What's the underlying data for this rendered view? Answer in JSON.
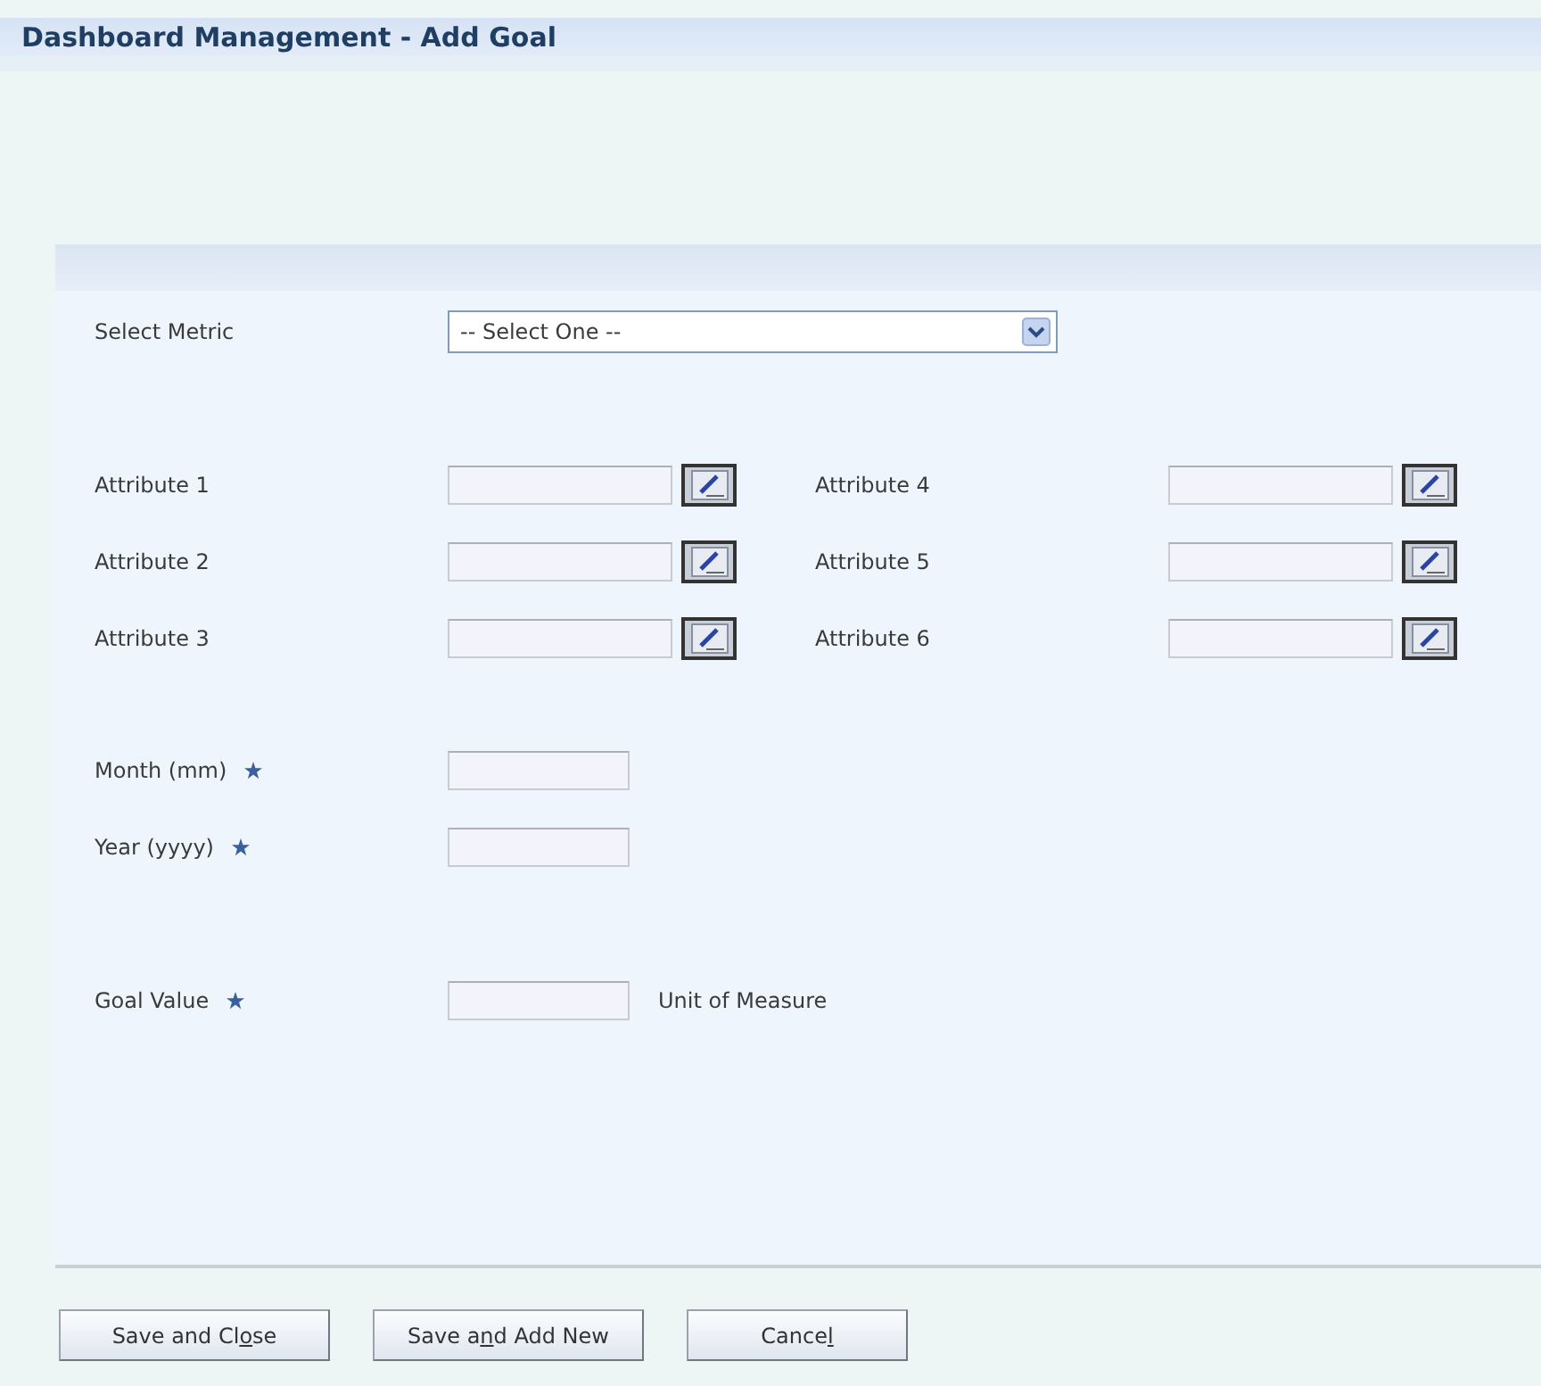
{
  "window": {
    "title": "Dashboard Management - Add Goal"
  },
  "metric": {
    "label": "Select Metric",
    "value": "-- Select One --"
  },
  "attributes": [
    {
      "label": "Attribute 1"
    },
    {
      "label": "Attribute 4"
    },
    {
      "label": "Attribute 2"
    },
    {
      "label": "Attribute 5"
    },
    {
      "label": "Attribute 3"
    },
    {
      "label": "Attribute 6"
    }
  ],
  "date_fields": [
    {
      "label": "Month (mm)",
      "required": true
    },
    {
      "label": "Year (yyyy)",
      "required": true
    }
  ],
  "goal": {
    "label": "Goal Value",
    "required": true,
    "unit_label": "Unit of Measure"
  },
  "buttons": [
    {
      "before": "Save and Cl",
      "access_key": "o",
      "after": "se"
    },
    {
      "before": "Save a",
      "access_key": "n",
      "after": "d Add New"
    },
    {
      "before": "Cance",
      "access_key": "l"
    }
  ]
}
